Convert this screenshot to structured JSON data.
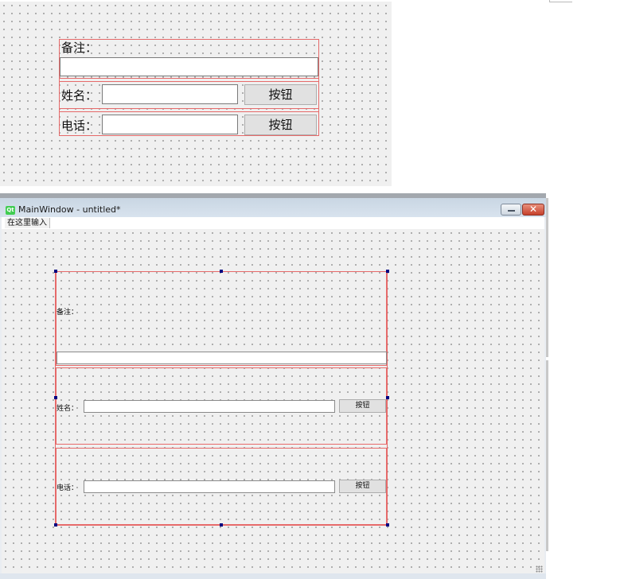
{
  "preview": {
    "note_label": "备注：",
    "name_label": "姓名：",
    "phone_label": "电话：",
    "name_button": "按钮",
    "phone_button": "按钮"
  },
  "window": {
    "app_icon": "Qt",
    "title": "MainWindow - untitled*",
    "menu_placeholder": "在这里输入",
    "close_glyph": "✕"
  },
  "form": {
    "note_label": "备注：",
    "note_value": "",
    "name_label": "姓名：",
    "name_value": "",
    "name_button": "按钮",
    "phone_label": "电话：",
    "phone_value": "",
    "phone_button": "按钮"
  },
  "colors": {
    "layout_border": "#e66a6a",
    "selection_handle": "#000080",
    "qt_green": "#41cd52",
    "close_red": "#c6412b"
  },
  "icons": {
    "app": "qt-logo-icon",
    "minimize": "minimize-icon",
    "close": "close-icon",
    "resize": "resize-grip-icon"
  }
}
